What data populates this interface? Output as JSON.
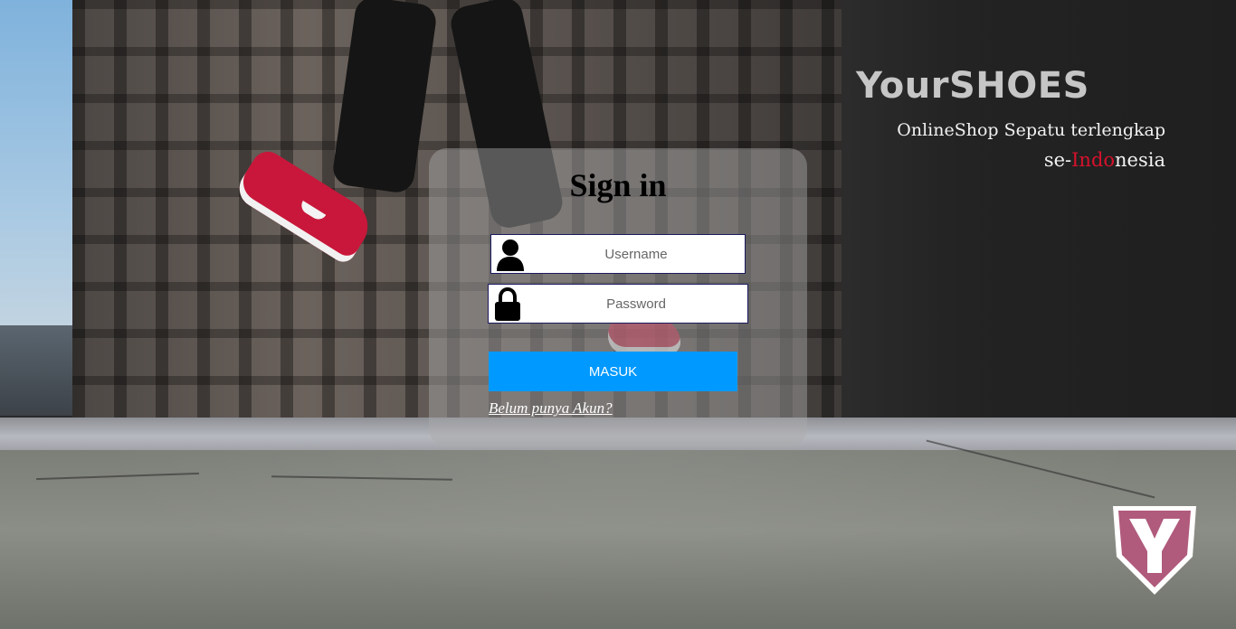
{
  "brand": {
    "logo_text": "YourSHOES",
    "tagline_line1": "OnlineShop Sepatu terlengkap",
    "tagline_line2_prefix": "se-",
    "tagline_line2_accent": "Indo",
    "tagline_line2_suffix": "nesia",
    "accent_color": "#d8112b"
  },
  "signin": {
    "title": "Sign in",
    "username": {
      "placeholder": "Username",
      "value": "",
      "icon": "user-icon"
    },
    "password": {
      "placeholder": "Password",
      "value": "",
      "icon": "lock-icon"
    },
    "submit_label": "MASUK",
    "submit_color": "#0099ff",
    "register_link": "Belum punya Akun?"
  },
  "badge": {
    "icon": "y-shield-badge-icon",
    "color": "#b05a7c"
  }
}
